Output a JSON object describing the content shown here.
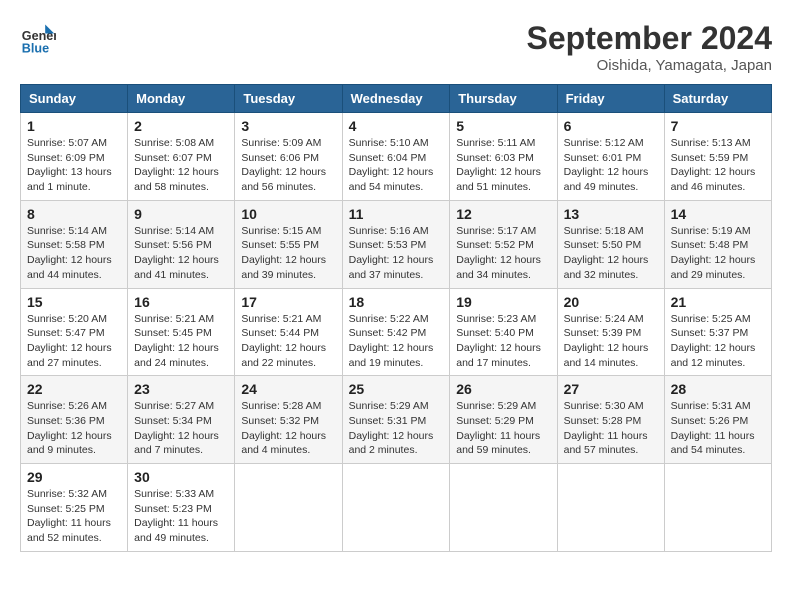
{
  "logo": {
    "text_general": "General",
    "text_blue": "Blue"
  },
  "header": {
    "month_title": "September 2024",
    "subtitle": "Oishida, Yamagata, Japan"
  },
  "weekdays": [
    "Sunday",
    "Monday",
    "Tuesday",
    "Wednesday",
    "Thursday",
    "Friday",
    "Saturday"
  ],
  "weeks": [
    [
      {
        "day": "1",
        "info": "Sunrise: 5:07 AM\nSunset: 6:09 PM\nDaylight: 13 hours\nand 1 minute."
      },
      {
        "day": "2",
        "info": "Sunrise: 5:08 AM\nSunset: 6:07 PM\nDaylight: 12 hours\nand 58 minutes."
      },
      {
        "day": "3",
        "info": "Sunrise: 5:09 AM\nSunset: 6:06 PM\nDaylight: 12 hours\nand 56 minutes."
      },
      {
        "day": "4",
        "info": "Sunrise: 5:10 AM\nSunset: 6:04 PM\nDaylight: 12 hours\nand 54 minutes."
      },
      {
        "day": "5",
        "info": "Sunrise: 5:11 AM\nSunset: 6:03 PM\nDaylight: 12 hours\nand 51 minutes."
      },
      {
        "day": "6",
        "info": "Sunrise: 5:12 AM\nSunset: 6:01 PM\nDaylight: 12 hours\nand 49 minutes."
      },
      {
        "day": "7",
        "info": "Sunrise: 5:13 AM\nSunset: 5:59 PM\nDaylight: 12 hours\nand 46 minutes."
      }
    ],
    [
      {
        "day": "8",
        "info": "Sunrise: 5:14 AM\nSunset: 5:58 PM\nDaylight: 12 hours\nand 44 minutes."
      },
      {
        "day": "9",
        "info": "Sunrise: 5:14 AM\nSunset: 5:56 PM\nDaylight: 12 hours\nand 41 minutes."
      },
      {
        "day": "10",
        "info": "Sunrise: 5:15 AM\nSunset: 5:55 PM\nDaylight: 12 hours\nand 39 minutes."
      },
      {
        "day": "11",
        "info": "Sunrise: 5:16 AM\nSunset: 5:53 PM\nDaylight: 12 hours\nand 37 minutes."
      },
      {
        "day": "12",
        "info": "Sunrise: 5:17 AM\nSunset: 5:52 PM\nDaylight: 12 hours\nand 34 minutes."
      },
      {
        "day": "13",
        "info": "Sunrise: 5:18 AM\nSunset: 5:50 PM\nDaylight: 12 hours\nand 32 minutes."
      },
      {
        "day": "14",
        "info": "Sunrise: 5:19 AM\nSunset: 5:48 PM\nDaylight: 12 hours\nand 29 minutes."
      }
    ],
    [
      {
        "day": "15",
        "info": "Sunrise: 5:20 AM\nSunset: 5:47 PM\nDaylight: 12 hours\nand 27 minutes."
      },
      {
        "day": "16",
        "info": "Sunrise: 5:21 AM\nSunset: 5:45 PM\nDaylight: 12 hours\nand 24 minutes."
      },
      {
        "day": "17",
        "info": "Sunrise: 5:21 AM\nSunset: 5:44 PM\nDaylight: 12 hours\nand 22 minutes."
      },
      {
        "day": "18",
        "info": "Sunrise: 5:22 AM\nSunset: 5:42 PM\nDaylight: 12 hours\nand 19 minutes."
      },
      {
        "day": "19",
        "info": "Sunrise: 5:23 AM\nSunset: 5:40 PM\nDaylight: 12 hours\nand 17 minutes."
      },
      {
        "day": "20",
        "info": "Sunrise: 5:24 AM\nSunset: 5:39 PM\nDaylight: 12 hours\nand 14 minutes."
      },
      {
        "day": "21",
        "info": "Sunrise: 5:25 AM\nSunset: 5:37 PM\nDaylight: 12 hours\nand 12 minutes."
      }
    ],
    [
      {
        "day": "22",
        "info": "Sunrise: 5:26 AM\nSunset: 5:36 PM\nDaylight: 12 hours\nand 9 minutes."
      },
      {
        "day": "23",
        "info": "Sunrise: 5:27 AM\nSunset: 5:34 PM\nDaylight: 12 hours\nand 7 minutes."
      },
      {
        "day": "24",
        "info": "Sunrise: 5:28 AM\nSunset: 5:32 PM\nDaylight: 12 hours\nand 4 minutes."
      },
      {
        "day": "25",
        "info": "Sunrise: 5:29 AM\nSunset: 5:31 PM\nDaylight: 12 hours\nand 2 minutes."
      },
      {
        "day": "26",
        "info": "Sunrise: 5:29 AM\nSunset: 5:29 PM\nDaylight: 11 hours\nand 59 minutes."
      },
      {
        "day": "27",
        "info": "Sunrise: 5:30 AM\nSunset: 5:28 PM\nDaylight: 11 hours\nand 57 minutes."
      },
      {
        "day": "28",
        "info": "Sunrise: 5:31 AM\nSunset: 5:26 PM\nDaylight: 11 hours\nand 54 minutes."
      }
    ],
    [
      {
        "day": "29",
        "info": "Sunrise: 5:32 AM\nSunset: 5:25 PM\nDaylight: 11 hours\nand 52 minutes."
      },
      {
        "day": "30",
        "info": "Sunrise: 5:33 AM\nSunset: 5:23 PM\nDaylight: 11 hours\nand 49 minutes."
      },
      null,
      null,
      null,
      null,
      null
    ]
  ]
}
